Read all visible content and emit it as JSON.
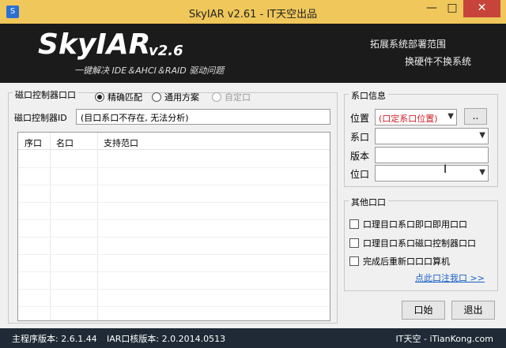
{
  "window": {
    "title": "SkyIAR v2.61 - IT天空出品",
    "minimize": "—",
    "maximize": "□",
    "close": "✕"
  },
  "banner": {
    "title": "SkyIAR",
    "version": "v2.6",
    "subtitle": "一键解决 IDE＆AHCI＆RAID 驱动问题",
    "right_line1": "拓展系统部署范围",
    "right_line2": "换硬件不换系统"
  },
  "left": {
    "group_label": "磁口控制器口口",
    "radios": [
      {
        "label": "精确匹配",
        "selected": true,
        "enabled": true
      },
      {
        "label": "通用方案",
        "selected": false,
        "enabled": true
      },
      {
        "label": "自定口",
        "selected": false,
        "enabled": false
      }
    ],
    "controller_id_label": "磁口控制器ID",
    "controller_id_value": "(目口系口不存在, 无法分析)",
    "table": {
      "columns": [
        "序口",
        "名口",
        "支持范口"
      ],
      "rows": []
    }
  },
  "system_info": {
    "group_label": "系口信息",
    "location_label": "位置",
    "location_value": "(口定系口位置)",
    "location_value_color": "#d0202a",
    "browse_button": "..",
    "system_label": "系口",
    "system_value": "",
    "version_label": "版本",
    "version_value": "",
    "bits_label": "位口",
    "bits_value": ""
  },
  "other": {
    "group_label": "其他口口",
    "options": [
      {
        "label": "口理目口系口即口即用口口",
        "checked": false
      },
      {
        "label": "口理目口系口磁口控制器口口",
        "checked": false
      },
      {
        "label": "完成后重新口口口算机",
        "checked": false
      }
    ],
    "register_link": "点此口注我口 >>"
  },
  "actions": {
    "start": "口始",
    "exit": "退出"
  },
  "status": {
    "main_version": "主程序版本: 2.6.1.44",
    "core_version": "IAR口核版本: 2.0.2014.0513",
    "site": "IT天空 - iTianKong.com"
  },
  "colors": {
    "titlebar": "#f0c75a",
    "close_button": "#c7443b",
    "banner": "#1b1b1b",
    "statusbar": "#1f2a36",
    "link": "#1a5fc9"
  }
}
